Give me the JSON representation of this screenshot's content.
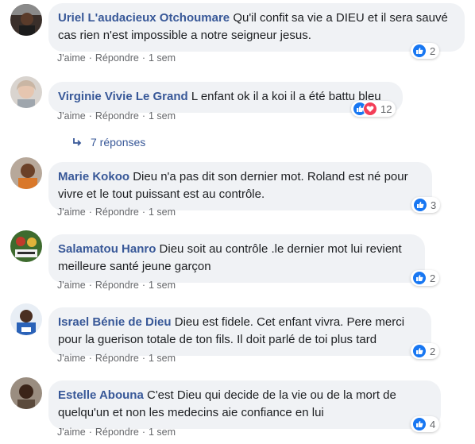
{
  "comments": [
    {
      "author": "Uriel L'audacieux Otchoumare",
      "text": "Qu'il confit sa vie a DIEU et il sera sauvé cas rien n'est impossible a notre seigneur jesus.",
      "like_label": "J'aime",
      "reply_label": "Répondre",
      "time": "1 sem",
      "reaction_count": "2"
    },
    {
      "author": "Virginie Vivie Le Grand",
      "text": "L enfant ok il a koi il a été battu bleu",
      "like_label": "J'aime",
      "reply_label": "Répondre",
      "time": "1 sem",
      "reaction_count": "12"
    },
    {
      "author": "Marie Kokoo",
      "text": "Dieu n'a pas dit son dernier mot. Roland est né pour vivre et le tout puissant est au contrôle.",
      "like_label": "J'aime",
      "reply_label": "Répondre",
      "time": "1 sem",
      "reaction_count": "3"
    },
    {
      "author": "Salamatou Hanro",
      "text": "Dieu soit au contrôle .le dernier mot lui revient meilleure santé jeune garçon",
      "like_label": "J'aime",
      "reply_label": "Répondre",
      "time": "1 sem",
      "reaction_count": "2"
    },
    {
      "author": "Israel Bénie de Dieu",
      "text": "Dieu est fidele. Cet enfant vivra. Pere merci pour la guerison totale de ton fils. Il doit parlé de toi plus tard",
      "like_label": "J'aime",
      "reply_label": "Répondre",
      "time": "1 sem",
      "reaction_count": "2"
    },
    {
      "author": "Estelle Abouna",
      "text": "C'est Dieu qui decide de la vie ou de la mort de quelqu'un et non les medecins aie confiance en lui",
      "like_label": "J'aime",
      "reply_label": "Répondre",
      "time": "1 sem",
      "reaction_count": "4"
    }
  ],
  "replies_link": "7 réponses",
  "colors": {
    "author": "#385898",
    "bubble": "#f0f2f5",
    "meta": "#65676b",
    "like": "#1877f2",
    "love": "#f33e58"
  },
  "icons": [
    "like-reaction-icon",
    "love-reaction-icon",
    "reply-arrow-icon"
  ]
}
